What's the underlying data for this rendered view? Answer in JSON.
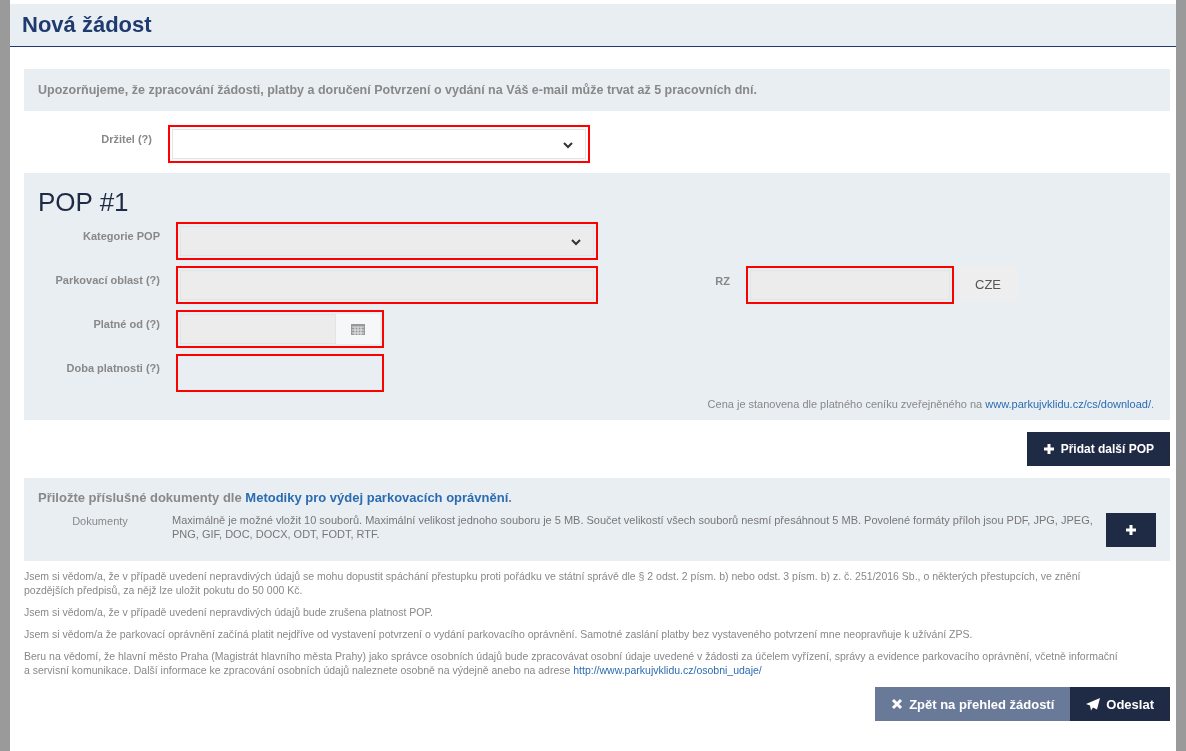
{
  "title": "Nová žádost",
  "notice": "Upozorňujeme, že zpracování žádosti, platby a doručení Potvrzení o vydání na Váš e-mail může trvat až 5 pracovních dní.",
  "holder": {
    "label": "Držitel (?)",
    "kind": "select",
    "highlighted": true
  },
  "pop": {
    "heading": "POP #1",
    "fields": [
      {
        "label": "Kategorie POP",
        "kind": "select",
        "highlighted": true
      },
      {
        "label": "Parkovací oblast (?)",
        "kind": "text",
        "highlighted": true
      },
      {
        "label": "Platné od (?)",
        "kind": "date",
        "highlighted": true
      },
      {
        "label": "Doba platnosti (?)",
        "kind": "blank",
        "highlighted": true
      }
    ],
    "rz": {
      "label": "RZ",
      "kind": "text",
      "highlighted": true,
      "addon": "CZE"
    },
    "price_note": {
      "before": "Cena je stanovena dle platného ceníku zveřejněného na ",
      "link": "www.parkujvklidu.cz/cs/download/",
      "after": "."
    }
  },
  "add_pop_button": "Přidat další POP",
  "documents": {
    "heading": {
      "before": "Přiložte příslušné dokumenty dle ",
      "link": "Metodiky pro výdej parkovacích oprávnění",
      "after": "."
    },
    "label": "Dokumenty",
    "info": "Maximálně je možné vložit 10 souborů. Maximální velikost jednoho souboru je 5 MB. Součet velikostí všech souborů nesmí přesáhnout 5 MB. Povolené formáty příloh jsou PDF, JPG, JPEG, PNG, GIF, DOC, DOCX, ODT, FODT, RTF."
  },
  "statements": [
    {
      "before": "Jsem si vědom/a, že v případě uvedení nepravdivých údajů se mohu dopustit spáchání přestupku proti pořádku ve státní správě dle § 2 odst. 2 písm. b) nebo odst. 3 písm. b) z. č. 251/2016 Sb., o některých přestupcích, ve znění pozdějších předpisů, za nějž lze uložit pokutu do 50 000 Kč."
    },
    {
      "before": "Jsem si vědom/a, že v případě uvedení nepravdivých údajů bude zrušena platnost POP."
    },
    {
      "before": "Jsem si vědom/a že parkovací oprávnění začíná platit nejdříve od vystavení potvrzení o vydání parkovacího oprávnění. Samotné zaslání platby bez vystaveného potvrzení mne neopravňuje k užívání ZPS."
    },
    {
      "before": "Beru na vědomí, že hlavní město Praha (Magistrát hlavního města Prahy) jako správce osobních údajů bude zpracovávat osobní údaje uvedené v žádosti za účelem vyřízení, správy a evidence parkovacího oprávnění, včetně informační a servisní komunikace. Další informace ke zpracování osobních údajů naleznete osobně na výdejně anebo na adrese ",
      "link": "http://www.parkujvklidu.cz/osobni_udaje/"
    }
  ],
  "buttons": [
    {
      "label": "Zpět na přehled žádostí",
      "kind": "back"
    },
    {
      "label": "Odeslat",
      "kind": "send"
    }
  ]
}
